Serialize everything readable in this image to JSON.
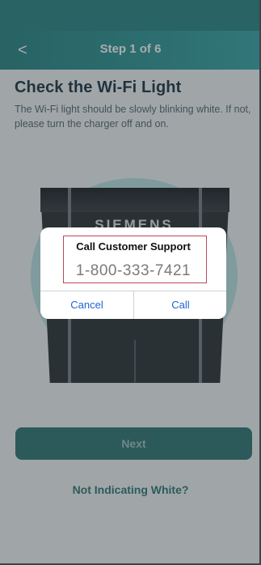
{
  "header": {
    "back_glyph": "<",
    "step_label": "Step 1 of 6"
  },
  "page": {
    "title": "Check the Wi-Fi Light",
    "instructions": "The Wi-Fi light should be slowly blinking white. If not, please turn the charger off and on."
  },
  "illustration": {
    "brand_text": "SIEMENS"
  },
  "dialog": {
    "title": "Call Customer Support",
    "phone": "1-800-333-7421",
    "cancel_label": "Cancel",
    "call_label": "Call"
  },
  "actions": {
    "next_label": "Next",
    "alt_link_label": "Not Indicating White?"
  },
  "colors": {
    "header_teal": "#1f8b8a",
    "primary_button": "#1f6b69",
    "dialog_action": "#1e64d8",
    "highlight_border": "#b84a5a"
  }
}
